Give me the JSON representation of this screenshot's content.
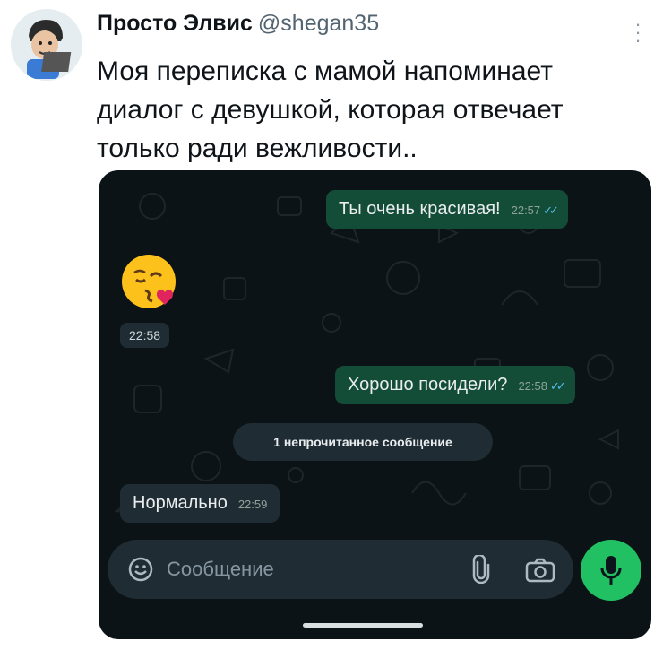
{
  "tweet": {
    "author_name": "Просто Элвис",
    "handle": "@shegan35",
    "text": "Моя переписка с мамой напоминает диалог с девушкой, которая отвечает только ради вежливости..",
    "more_icon": "more-vertical-icon"
  },
  "chat": {
    "messages": [
      {
        "direction": "outgoing",
        "text": "Ты очень красивая!",
        "time": "22:57",
        "status": "read"
      },
      {
        "direction": "incoming",
        "type": "emoji",
        "emoji_name": "face-blowing-a-kiss",
        "time": "22:58"
      },
      {
        "direction": "outgoing",
        "text": "Хорошо посидели?",
        "time": "22:58",
        "status": "read"
      },
      {
        "direction": "incoming",
        "text": "Нормально",
        "time": "22:59"
      }
    ],
    "unread_divider": "1 непрочитанное сообщение",
    "input": {
      "placeholder": "Сообщение",
      "left_icon": "sticker-icon",
      "icons": [
        "paperclip-icon",
        "camera-icon"
      ]
    },
    "send_icon": "microphone-icon",
    "colors": {
      "background": "#0c1317",
      "outgoing_bubble": "#144d37",
      "incoming_bubble": "#202c33",
      "accent": "#21c063",
      "read_ticks": "#53bdeb"
    }
  }
}
